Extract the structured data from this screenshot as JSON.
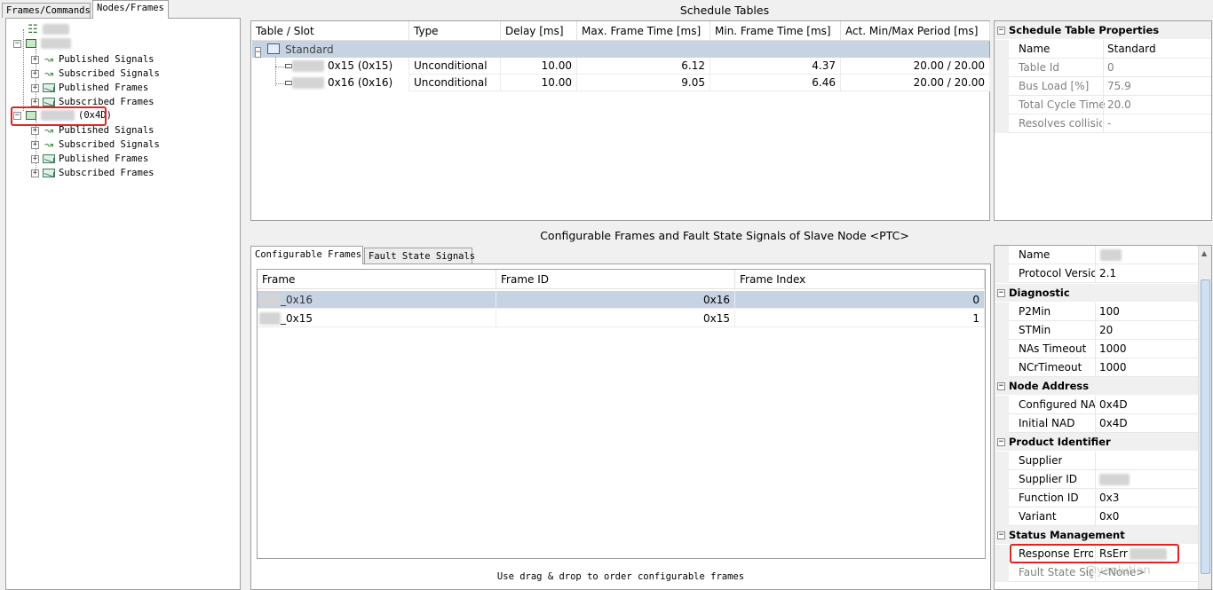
{
  "left": {
    "tabs": [
      "Frames/Commands",
      "Nodes/Frames"
    ],
    "tree": {
      "node1_children": [
        "Published Signals",
        "Subscribed Signals",
        "Published Frames",
        "Subscribed Frames"
      ],
      "node2_label": "(0x4D)",
      "node2_children": [
        "Published Signals",
        "Subscribed Signals",
        "Published Frames",
        "Subscribed Frames"
      ]
    }
  },
  "schedule": {
    "title": "Schedule Tables",
    "columns": [
      "Table / Slot",
      "Type",
      "Delay [ms]",
      "Max. Frame Time [ms]",
      "Min. Frame Time [ms]",
      "Act. Min/Max Period [ms]"
    ],
    "table_name": "Standard",
    "rows": [
      {
        "slot": "0x15 (0x15)",
        "type": "Unconditional",
        "delay": "10.00",
        "max": "6.12",
        "min": "4.37",
        "period": "20.00 / 20.00"
      },
      {
        "slot": "0x16 (0x16)",
        "type": "Unconditional",
        "delay": "10.00",
        "max": "9.05",
        "min": "6.46",
        "period": "20.00 / 20.00"
      }
    ]
  },
  "sched_props": {
    "title": "Schedule Table Properties",
    "rows": [
      {
        "name": "Name",
        "value": "Standard"
      },
      {
        "name": "Table Id",
        "value": "0"
      },
      {
        "name": "Bus Load [%]",
        "value": "75.9"
      },
      {
        "name": "Total Cycle Time",
        "value": "20.0"
      },
      {
        "name": "Resolves collisions",
        "value": "-"
      }
    ]
  },
  "config": {
    "title": "Configurable Frames and Fault State Signals of Slave Node <PTC>",
    "tabs": [
      "Configurable Frames",
      "Fault State Signals"
    ],
    "columns": [
      "Frame",
      "Frame ID",
      "Frame Index"
    ],
    "rows": [
      {
        "frame": "_0x16",
        "id": "0x16",
        "index": "0"
      },
      {
        "frame": "_0x15",
        "id": "0x15",
        "index": "1"
      }
    ],
    "hint": "Use drag & drop to order configurable frames"
  },
  "node_props": {
    "top": [
      {
        "name": "Name",
        "value": ""
      },
      {
        "name": "Protocol Version",
        "value": "2.1"
      }
    ],
    "diagnostic": {
      "label": "Diagnostic",
      "rows": [
        {
          "name": "P2Min",
          "value": "100"
        },
        {
          "name": "STMin",
          "value": "20"
        },
        {
          "name": "NAs Timeout",
          "value": "1000"
        },
        {
          "name": "NCrTimeout",
          "value": "1000"
        }
      ]
    },
    "node_address": {
      "label": "Node Address",
      "rows": [
        {
          "name": "Configured NAD",
          "value": "0x4D"
        },
        {
          "name": "Initial NAD",
          "value": "0x4D"
        }
      ]
    },
    "product": {
      "label": "Product Identifier",
      "rows": [
        {
          "name": "Supplier",
          "value": ""
        },
        {
          "name": "Supplier ID",
          "value": ""
        },
        {
          "name": "Function ID",
          "value": "0x3"
        },
        {
          "name": "Variant",
          "value": "0x0"
        }
      ]
    },
    "status": {
      "label": "Status Management",
      "rows": [
        {
          "name": "Response Error",
          "value": "RsErr"
        },
        {
          "name": "Fault State Signals",
          "value": "<None>"
        }
      ]
    }
  },
  "watermark": "@yanlutian"
}
